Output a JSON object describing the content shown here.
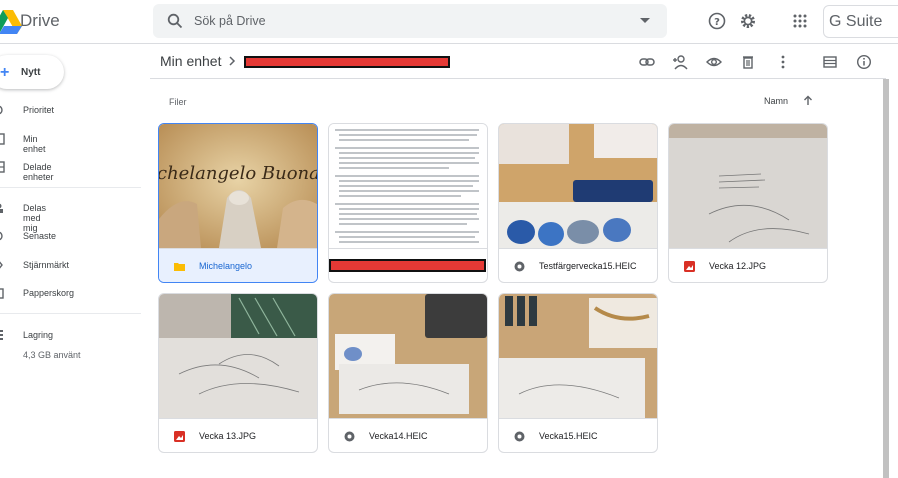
{
  "header": {
    "app_name": "Drive",
    "search_placeholder": "Sök på Drive",
    "suite_label": "G Suite",
    "icons": [
      "help-icon",
      "gear-icon",
      "apps-grid-icon"
    ]
  },
  "sidebar": {
    "new_label": "Nytt",
    "items": [
      {
        "label": "Prioritet",
        "icon": "priority-icon"
      },
      {
        "label": "Min enhet",
        "icon": "my-drive-icon"
      },
      {
        "label": "Delade enheter",
        "icon": "shared-drives-icon"
      },
      {
        "label": "Delas med mig",
        "icon": "shared-with-me-icon"
      },
      {
        "label": "Senaste",
        "icon": "clock-icon"
      },
      {
        "label": "Stjärnmärkt",
        "icon": "star-icon"
      },
      {
        "label": "Papperskorg",
        "icon": "trash-icon"
      },
      {
        "label": "Lagring",
        "icon": "storage-icon"
      }
    ],
    "storage_used": "4,3 GB använt"
  },
  "toolbar": {
    "breadcrumb_root": "Min enhet",
    "icons": [
      "link-icon",
      "add-person-icon",
      "preview-eye-icon",
      "delete-icon",
      "more-vert-icon",
      "list-view-icon",
      "info-icon"
    ]
  },
  "section_label": "Filer",
  "sort_label": "Namn",
  "colors": {
    "accent": "#4285f4",
    "folder": "#fbbc04",
    "image": "#d93025",
    "heic": "#5f6368"
  },
  "files": [
    {
      "name": "Michelangelo",
      "type": "folder",
      "thumb_text": "chelangelo Buonarrot"
    },
    {
      "name": "",
      "type": "document-redacted"
    },
    {
      "name": "Testfärgervecka15.HEIC",
      "type": "heic"
    },
    {
      "name": "Vecka 12.JPG",
      "type": "image"
    },
    {
      "name": "Vecka 13.JPG",
      "type": "image"
    },
    {
      "name": "Vecka14.HEIC",
      "type": "heic"
    },
    {
      "name": "Vecka15.HEIC",
      "type": "heic"
    }
  ]
}
